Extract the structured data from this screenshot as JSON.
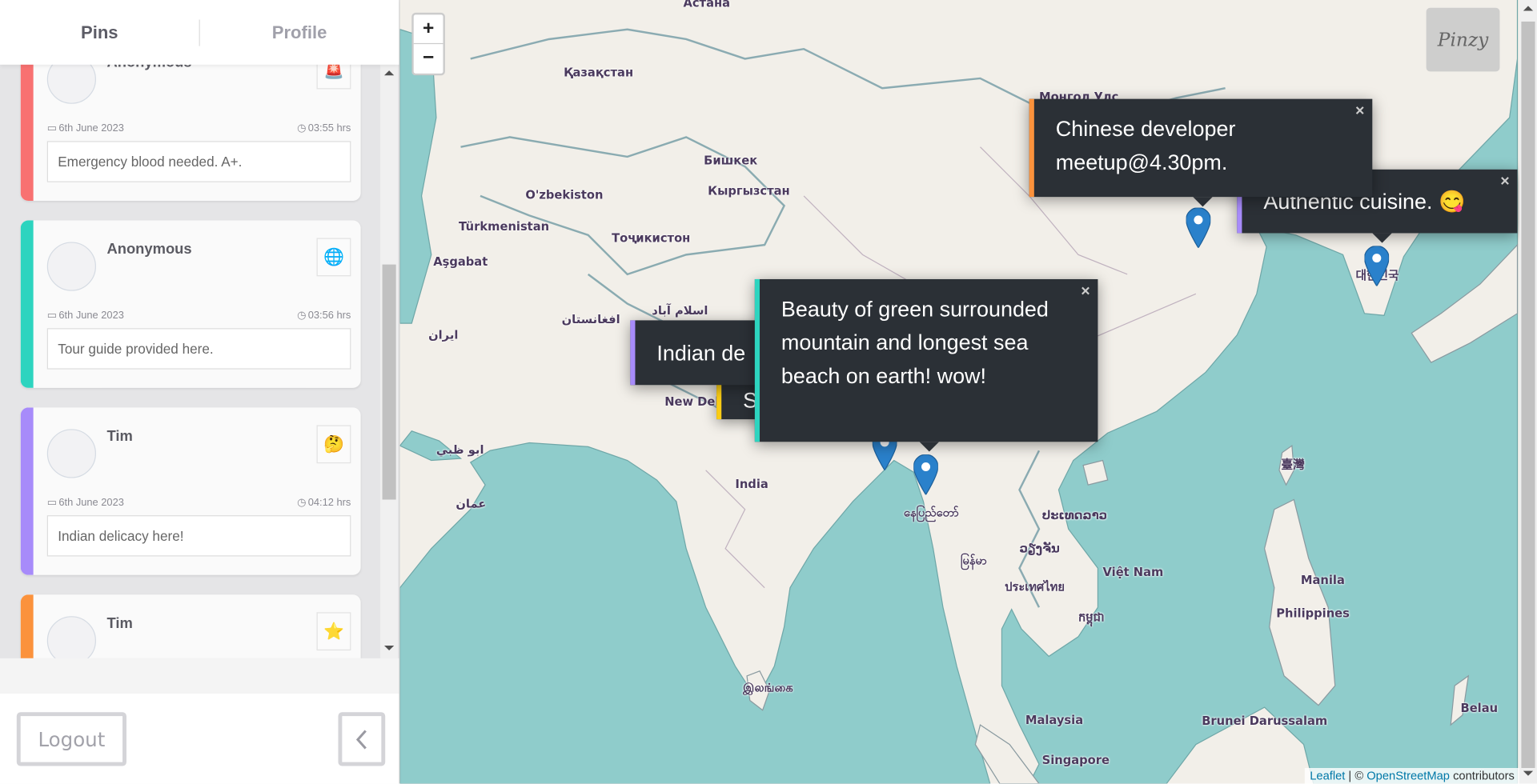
{
  "tabs": [
    {
      "label": "Pins",
      "active": true
    },
    {
      "label": "Profile",
      "active": false
    }
  ],
  "pins": [
    {
      "user": "Anonymous",
      "icon": "🚨",
      "icon_name": "siren-icon",
      "date": "6th June 2023",
      "time": "03:55 hrs",
      "message": "Emergency blood needed. A+.",
      "color": "#f87171"
    },
    {
      "user": "Anonymous",
      "icon": "🌐",
      "icon_name": "globe-icon",
      "date": "6th June 2023",
      "time": "03:56 hrs",
      "message": "Tour guide provided here.",
      "color": "#2dd4bf"
    },
    {
      "user": "Tim",
      "icon": "🤔",
      "icon_name": "thinking-face-icon",
      "date": "6th June 2023",
      "time": "04:12 hrs",
      "message": "Indian delicacy here!",
      "color": "#a78bfa"
    },
    {
      "user": "Tim",
      "icon": "⭐",
      "icon_name": "star-icon",
      "color": "#fb923c"
    }
  ],
  "footer": {
    "logout_label": "Logout"
  },
  "map": {
    "logo_text": "Pinzy",
    "zoom_in": "+",
    "zoom_out": "−",
    "attribution": {
      "leaflet": "Leaflet",
      "sep": " | © ",
      "osm": "OpenStreetMap",
      "suffix": " contributors"
    },
    "labels": [
      "Астана",
      "Қазақстан",
      "Бишкек",
      "Кыргызстан",
      "O'zbekiston",
      "Türkmenistan",
      "Тоҷикистон",
      "Aşgabat",
      "افغانستان",
      "ایران",
      "اسلام آباد",
      "New Del",
      "India",
      "ابو ظبي",
      "عمان",
      "နေပြည်တော်",
      "မြန်မာ",
      "ປະເທດລາວ",
      "ວຽງຈັນ",
      "Việt Nam",
      "ประเทศไทย",
      "កម្ពុជា",
      "Manila",
      "Philippines",
      "臺灣",
      "Malaysia",
      "Brunei Darussalam",
      "Singapore",
      "Belau",
      "இலங்கை",
      "Монгол Улс",
      "대한민국"
    ],
    "popups": [
      {
        "text": "Indian de",
        "color": "#a78bfa"
      },
      {
        "text": "S",
        "color": "#facc15"
      },
      {
        "text": "Authentic cuisine. 😋",
        "color": "#a78bfa"
      },
      {
        "text": "Chinese developer meetup@4.30pm.",
        "color": "#fb923c"
      },
      {
        "text": "Beauty of green surrounded mountain and longest sea beach on earth! wow!",
        "color": "#2dd4bf"
      }
    ],
    "close_glyph": "×",
    "marker_color": "#2a81cb"
  }
}
